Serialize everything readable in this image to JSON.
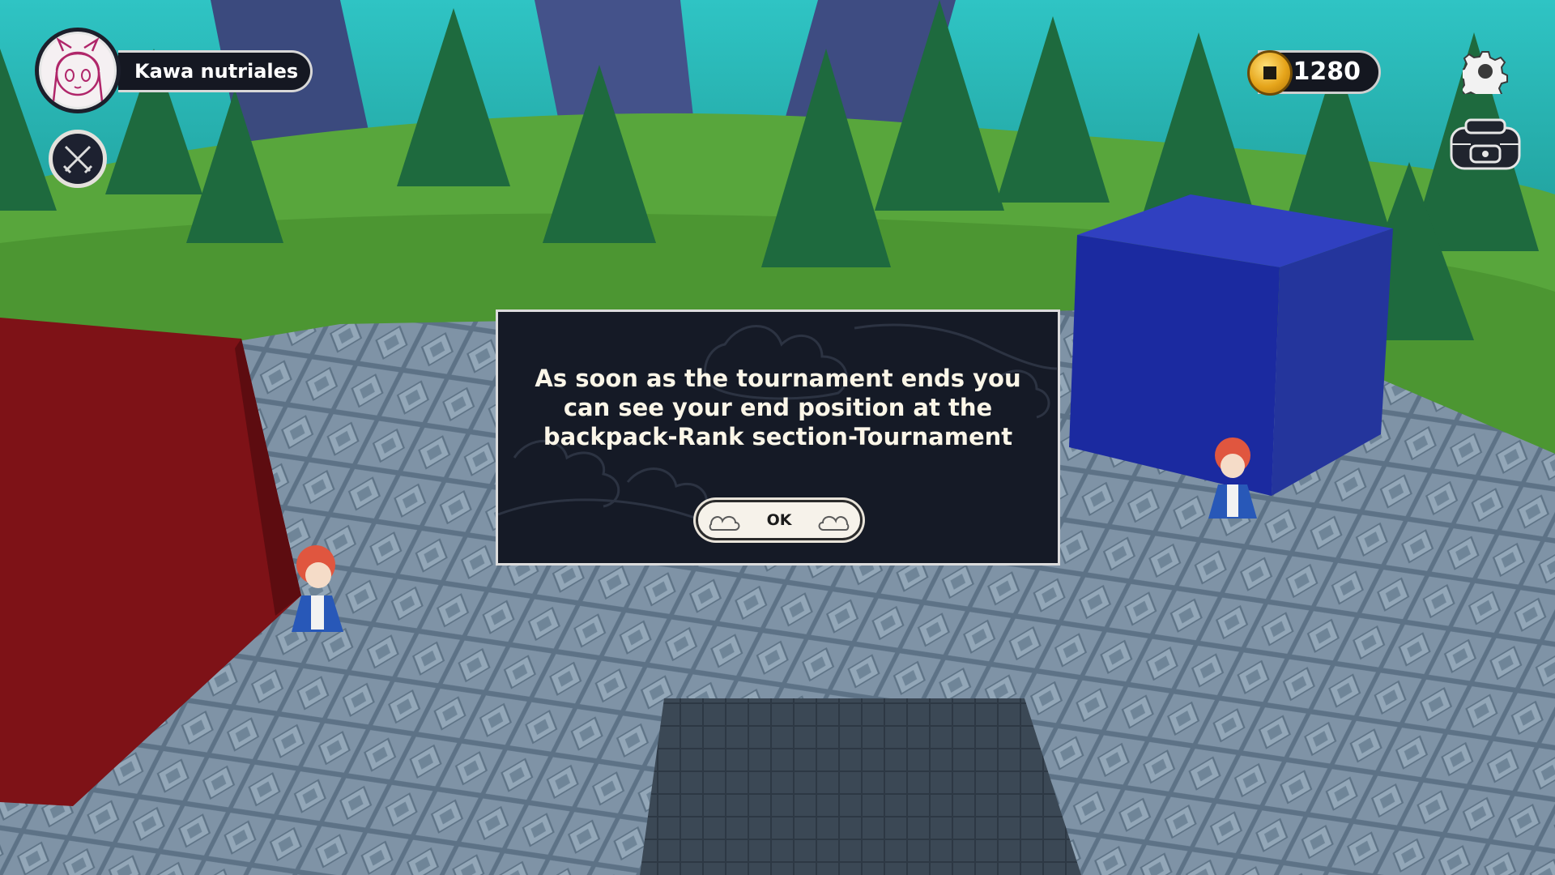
{
  "player": {
    "name": "Kawa nutriales",
    "avatar_icon": "avatar-portrait-icon"
  },
  "hud": {
    "coins": "1280",
    "coin_icon": "coin-icon",
    "battle_icon": "crossed-swords-icon",
    "settings_icon": "gear-icon",
    "backpack_icon": "backpack-icon"
  },
  "dialog": {
    "line1": "As soon as the tournament ends you",
    "line2": "can see your end position at the",
    "line3": "backpack-Rank section-Tournament",
    "ok_label": "OK"
  },
  "colors": {
    "panel": "#151a26",
    "panel_border": "#dcdcdc",
    "text": "#fbf6e8",
    "red_cube": "#7e1217",
    "blue_cube": "#1b2aa0"
  }
}
